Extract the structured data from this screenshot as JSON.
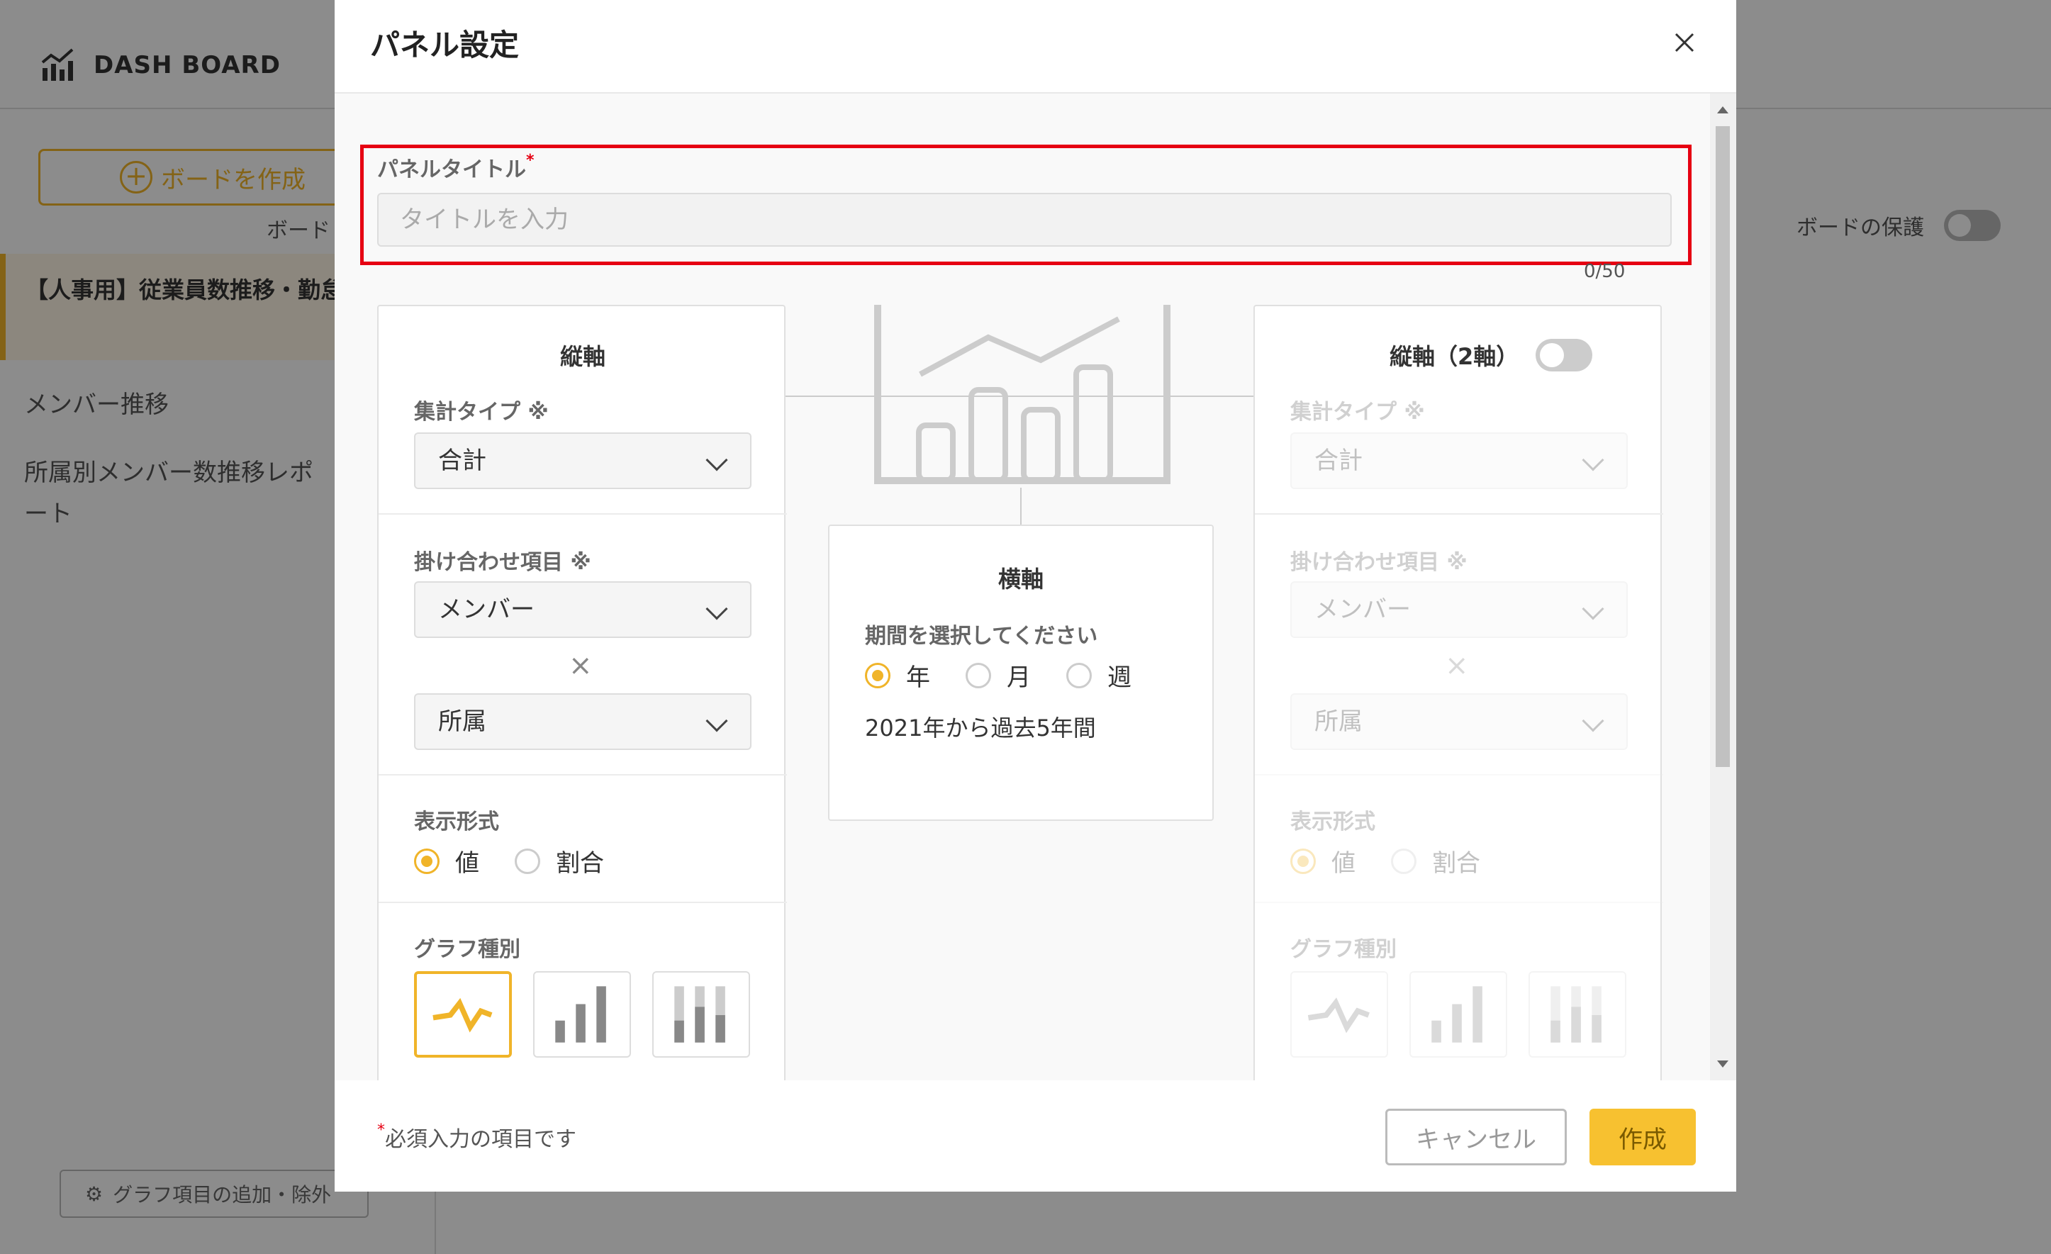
{
  "app": {
    "brand": "DASH BOARD",
    "sidebar": {
      "create_board": "ボードを作成",
      "board_sub": "ボード",
      "active_board": "【人事用】従業員数推移・勤怠・有給",
      "items": [
        "メンバー推移",
        "所属別メンバー数推移レポート"
      ],
      "graph_edit": "グラフ項目の追加・除外"
    },
    "board_protect": "ボードの保護"
  },
  "modal": {
    "title": "パネル設定",
    "panel_title_label": "パネルタイトル",
    "required_mark": "*",
    "title_placeholder": "タイトルを入力",
    "char_count": "0/50",
    "left": {
      "head": "縦軸",
      "agg_label": "集計タイプ ※",
      "agg_value": "合計",
      "combo_label": "掛け合わせ項目 ※",
      "combo1": "メンバー",
      "times": "×",
      "combo2": "所属",
      "display_label": "表示形式",
      "display_opt1": "値",
      "display_opt2": "割合",
      "graph_label": "グラフ種別"
    },
    "right": {
      "head": "縦軸（2軸）",
      "agg_label": "集計タイプ ※",
      "agg_value": "合計",
      "combo_label": "掛け合わせ項目 ※",
      "combo1": "メンバー",
      "times": "×",
      "combo2": "所属",
      "display_label": "表示形式",
      "display_opt1": "値",
      "display_opt2": "割合",
      "graph_label": "グラフ種別"
    },
    "center": {
      "head": "横軸",
      "period_label": "期間を選択してください",
      "opt_year": "年",
      "opt_month": "月",
      "opt_week": "週",
      "range_text": "2021年から過去5年間"
    },
    "footer": {
      "note": "必須入力の項目です",
      "cancel": "キャンセル",
      "create": "作成"
    }
  },
  "colors": {
    "accent": "#f0b429",
    "highlight": "#e60012",
    "primary_btn": "#f7c130"
  }
}
